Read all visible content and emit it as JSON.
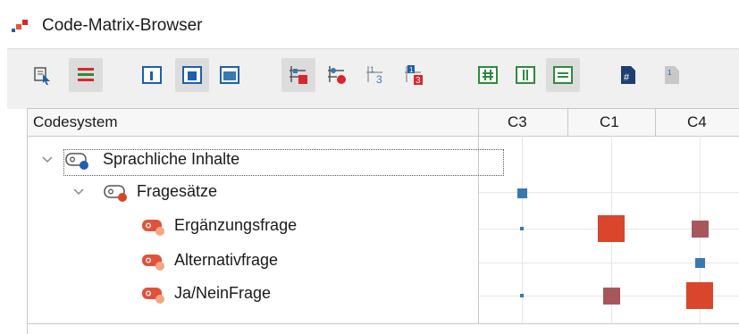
{
  "window": {
    "title": "Code-Matrix-Browser"
  },
  "toolbar": {
    "buttons": [
      {
        "name": "select-documents-icon",
        "active": false
      },
      {
        "name": "codes-bars-icon",
        "active": true
      },
      {
        "name": "layout-left-icon",
        "active": false
      },
      {
        "name": "layout-center-icon",
        "active": true
      },
      {
        "name": "layout-full-icon",
        "active": false
      },
      {
        "name": "symbol-squares-icon",
        "active": true
      },
      {
        "name": "symbol-circles-icon",
        "active": false
      },
      {
        "name": "values-icon",
        "active": false
      },
      {
        "name": "values-colored-icon",
        "active": false
      },
      {
        "name": "hash-grid-icon",
        "active": false
      },
      {
        "name": "columns-icon",
        "active": false
      },
      {
        "name": "rows-icon",
        "active": true
      },
      {
        "name": "hash-document-icon",
        "active": false
      },
      {
        "name": "numbers-document-icon",
        "active": false
      }
    ]
  },
  "matrix": {
    "header": {
      "codesystem": "Codesystem",
      "columns": [
        "C3",
        "C1",
        "C4"
      ]
    },
    "rows": [
      {
        "label": "Sprachliche Inhalte",
        "level": 0,
        "expanded": true,
        "icon_color": "#1f5fad",
        "selected": true
      },
      {
        "label": "Fragesätze",
        "level": 1,
        "expanded": true,
        "icon_color": "#d9462b"
      },
      {
        "label": "Ergänzungsfrage",
        "level": 2,
        "icon_color": "#f4a582"
      },
      {
        "label": "Alternativfrage",
        "level": 2,
        "icon_color": "#f4a582"
      },
      {
        "label": "Ja/NeinFrage",
        "level": 2,
        "icon_color": "#f4a582"
      }
    ],
    "cells": [
      {
        "row": 1,
        "col": 0,
        "size": 2,
        "color": "#3a78b0"
      },
      {
        "row": 2,
        "col": 0,
        "size": 1,
        "color": "#3a78b0"
      },
      {
        "row": 2,
        "col": 1,
        "size": 5,
        "color": "#d9462b"
      },
      {
        "row": 2,
        "col": 2,
        "size": 3,
        "color": "#a8565b"
      },
      {
        "row": 3,
        "col": 2,
        "size": 2,
        "color": "#3a78b0"
      },
      {
        "row": 4,
        "col": 0,
        "size": 1,
        "color": "#3a78b0"
      },
      {
        "row": 4,
        "col": 1,
        "size": 3,
        "color": "#a8565b"
      },
      {
        "row": 4,
        "col": 2,
        "size": 5,
        "color": "#d9462b"
      }
    ]
  }
}
